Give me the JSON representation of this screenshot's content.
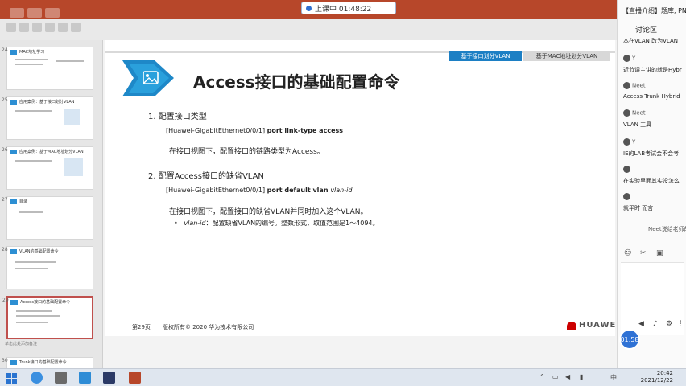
{
  "live_indicator": {
    "label": "上课中 01:48:22"
  },
  "thumbnails": [
    {
      "num": "24",
      "title": "MAC地址学习"
    },
    {
      "num": "25",
      "title": "应用案例：基于接口划分VLAN"
    },
    {
      "num": "26",
      "title": "应用案例：基于MAC地址划分VLAN"
    },
    {
      "num": "27",
      "title": "目录"
    },
    {
      "num": "28",
      "title": "VLAN的基础配置命令"
    },
    {
      "num": "29",
      "title": "Access接口的基础配置命令"
    },
    {
      "num": "30",
      "title": "Trunk接口的基础配置命令"
    }
  ],
  "notes_hint": "单击此处添加备注",
  "slide": {
    "nav_active": "基于接口划分VLAN",
    "nav_inactive": "基于MAC地址划分VLAN",
    "title": "Access接口的基础配置命令",
    "item1": {
      "heading": "1.    配置接口类型",
      "cmd_prefix": "[Huawei-GigabitEthernet0/0/1] ",
      "cmd_bold": "port link-type access",
      "desc": "在接口视图下，配置接口的链路类型为Access。"
    },
    "item2": {
      "heading": "2.    配置Access接口的缺省VLAN",
      "cmd_prefix": "[Huawei-GigabitEthernet0/0/1] ",
      "cmd_bold": "port default vlan ",
      "cmd_italic": "vlan-id",
      "desc": "在接口视图下，配置接口的缺省VLAN并同时加入这个VLAN。",
      "bullet_italic": "vlan-id",
      "bullet_text": "：配置缺省VLAN的编号。整数形式，取值范围是1～4094。"
    },
    "footer_page": "第29页",
    "footer_copyright": "版权所有© 2020 华为技术有限公司",
    "brand": "HUAWEI"
  },
  "chat": {
    "header": "【直播介绍】题库, PN",
    "title": "讨论区",
    "messages": [
      {
        "name": "",
        "text": "本在VLAN 改为VLAN"
      },
      {
        "name": "Y",
        "text": "近节课主讲的就是Hybr"
      },
      {
        "name": "Neet",
        "text": "Access Trunk Hybrid"
      },
      {
        "name": "Neet",
        "text": "VLAN 工具"
      },
      {
        "name": "Y",
        "text": "IE的LAB考试会不会考"
      },
      {
        "name": "",
        "text": "在实验里面其实没怎么"
      },
      {
        "name": "",
        "text": "就平时 而言"
      },
      {
        "name": "",
        "text": "Neet说给老师的"
      }
    ],
    "timer": "01:58"
  },
  "taskbar": {
    "time": "20:42",
    "date": "2021/12/22",
    "lang": "中"
  }
}
